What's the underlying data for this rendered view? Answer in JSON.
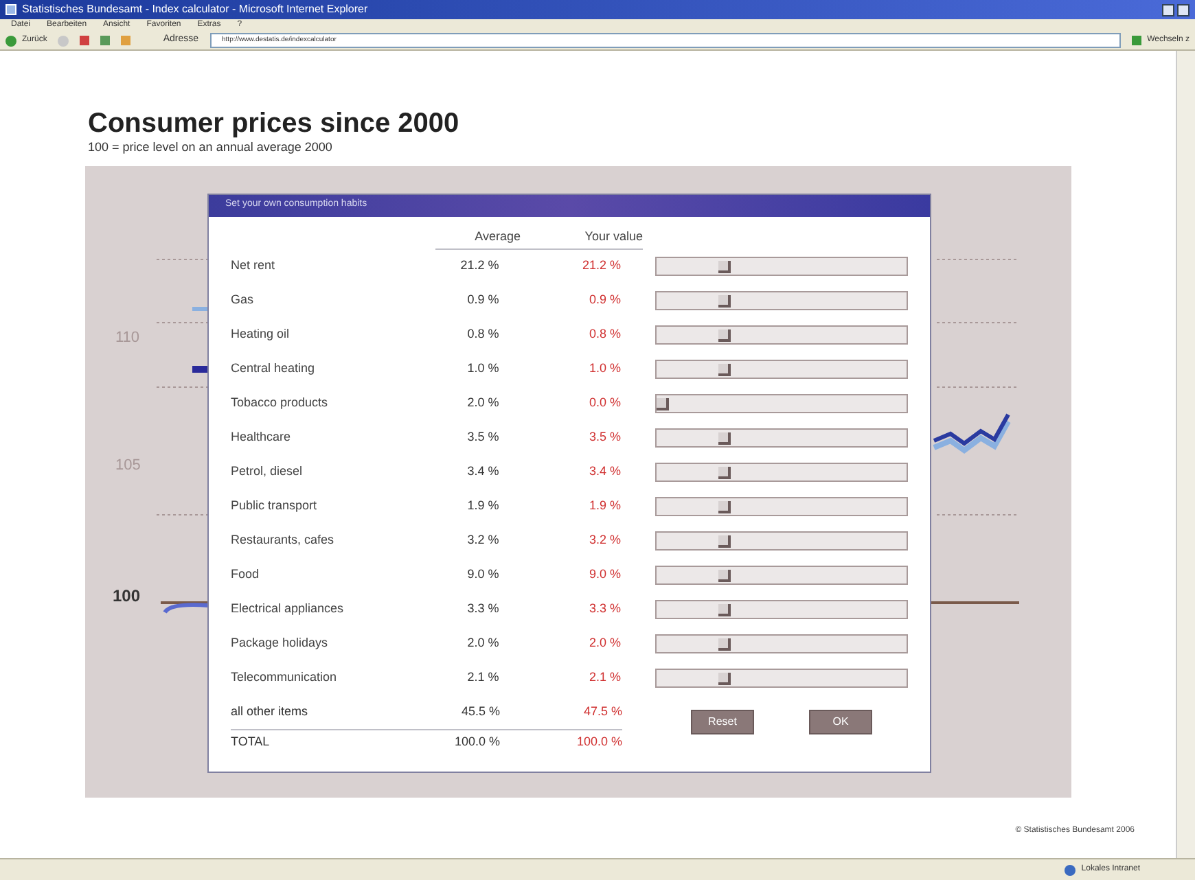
{
  "window": {
    "title": "Statistisches Bundesamt - Index calculator - Microsoft Internet Explorer"
  },
  "menu": [
    "Datei",
    "Bearbeiten",
    "Ansicht",
    "Favoriten",
    "Extras",
    "?"
  ],
  "toolbar": {
    "back_label": "Zurück",
    "address_label": "Adresse",
    "url": "http://www.destatis.de/indexcalculator",
    "go_label": "Wechseln z"
  },
  "page": {
    "title": "Consumer prices since 2000",
    "subtitle": "100 = price level on an annual average 2000",
    "chart": {
      "y_labels": [
        "110",
        "105",
        "100"
      ]
    },
    "dialog": {
      "title": "Set your own consumption habits",
      "columns": [
        "Average",
        "Your value"
      ],
      "rows": [
        {
          "label": "Net rent",
          "average": "21.2 %",
          "your_value": "21.2 %",
          "level": 0.26
        },
        {
          "label": "Gas",
          "average": "0.9 %",
          "your_value": "0.9 %",
          "level": 0.26
        },
        {
          "label": "Heating oil",
          "average": "0.8 %",
          "your_value": "0.8 %",
          "level": 0.26
        },
        {
          "label": "Central heating",
          "average": "1.0 %",
          "your_value": "1.0 %",
          "level": 0.26
        },
        {
          "label": "Tobacco products",
          "average": "2.0 %",
          "your_value": "0.0 %",
          "level": 0
        },
        {
          "label": "Healthcare",
          "average": "3.5 %",
          "your_value": "3.5 %",
          "level": 0.26
        },
        {
          "label": "Petrol, diesel",
          "average": "3.4 %",
          "your_value": "3.4 %",
          "level": 0.26
        },
        {
          "label": "Public transport",
          "average": "1.9 %",
          "your_value": "1.9 %",
          "level": 0.26
        },
        {
          "label": "Restaurants, cafes",
          "average": "3.2 %",
          "your_value": "3.2 %",
          "level": 0.26
        },
        {
          "label": "Food",
          "average": "9.0 %",
          "your_value": "9.0 %",
          "level": 0.26
        },
        {
          "label": "Electrical appliances",
          "average": "3.3 %",
          "your_value": "3.3 %",
          "level": 0.26
        },
        {
          "label": "Package holidays",
          "average": "2.0 %",
          "your_value": "2.0 %",
          "level": 0.26
        },
        {
          "label": "Telecommunication",
          "average": "2.1 %",
          "your_value": "2.1 %",
          "level": 0.26
        }
      ],
      "totals": [
        {
          "kind": "rest",
          "label": "all other items",
          "average": "45.5 %",
          "your_value": "47.5 %"
        },
        {
          "kind": "total",
          "label": "TOTAL",
          "average": "100.0 %",
          "your_value": "100.0 %"
        }
      ],
      "buttons": [
        "Reset",
        "OK"
      ]
    },
    "copyright": "© Statistisches Bundesamt 2006"
  },
  "status_bar": {
    "zone": "Lokales Intranet"
  }
}
